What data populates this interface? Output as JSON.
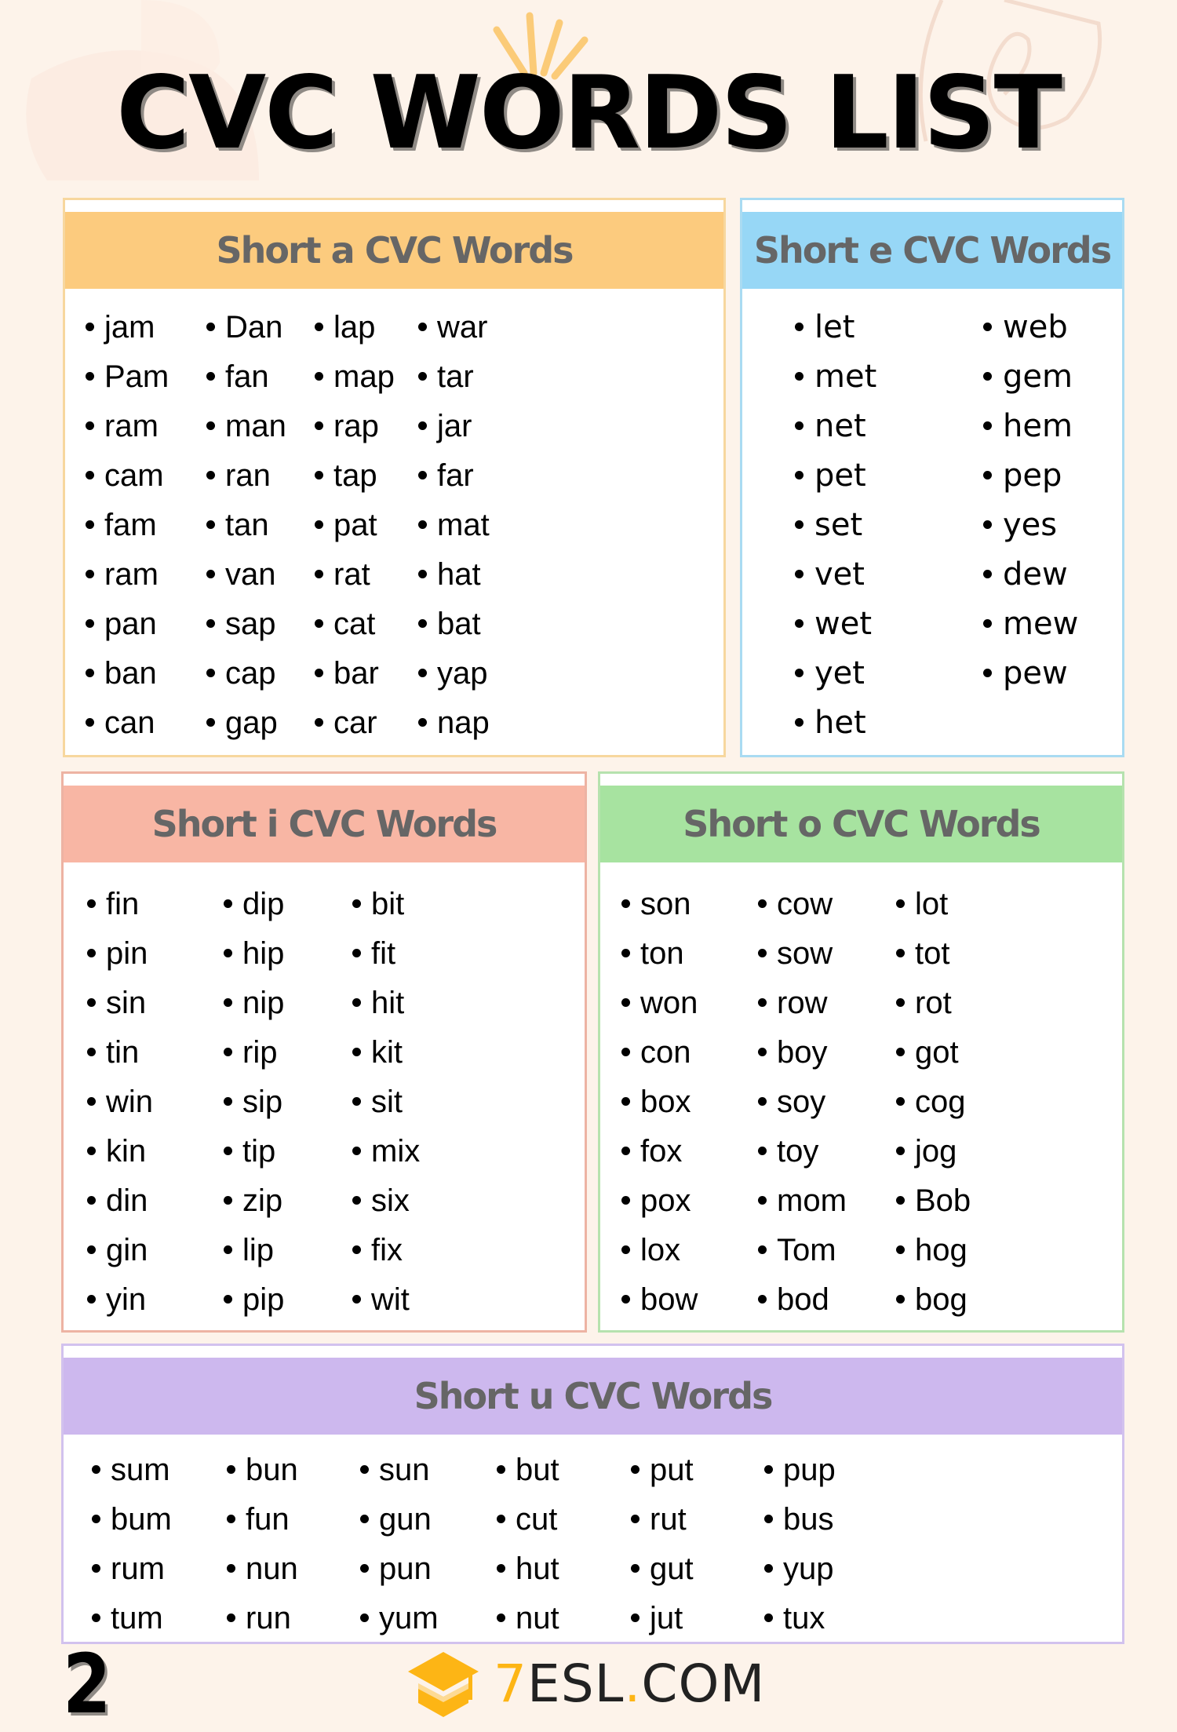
{
  "title": "CVC WORDS LIST",
  "colors": {
    "background": "#FDF3EA",
    "short_a": "#FCCB7E",
    "short_e": "#97D7F6",
    "short_i": "#F8B6A4",
    "short_o": "#A7E3A0",
    "short_u": "#CDB8EE",
    "header_text": "#666666",
    "logo_accent": "#FDB515"
  },
  "sections": {
    "a": {
      "heading": "Short a CVC Words",
      "columns": [
        [
          "jam",
          "Pam",
          "ram",
          "cam",
          "fam",
          "ram",
          "pan",
          "ban",
          "can"
        ],
        [
          "Dan",
          "fan",
          "man",
          "ran",
          "tan",
          "van",
          "sap",
          "cap",
          "gap"
        ],
        [
          "lap",
          "map",
          "rap",
          "tap",
          "pat",
          "rat",
          "cat",
          "bar",
          "car"
        ],
        [
          "war",
          "tar",
          "jar",
          "far",
          "mat",
          "hat",
          "bat",
          "yap",
          "nap"
        ]
      ]
    },
    "e": {
      "heading": "Short e CVC Words",
      "columns": [
        [
          "let",
          "met",
          "net",
          "pet",
          "set",
          "vet",
          "wet",
          "yet",
          "het"
        ],
        [
          "web",
          "gem",
          "hem",
          "pep",
          "yes",
          "dew",
          "mew",
          "pew"
        ]
      ]
    },
    "i": {
      "heading": "Short i CVC Words",
      "columns": [
        [
          "fin",
          "pin",
          "sin",
          "tin",
          "win",
          "kin",
          "din",
          "gin",
          "yin"
        ],
        [
          "dip",
          "hip",
          "nip",
          "rip",
          "sip",
          "tip",
          "zip",
          "lip",
          "pip"
        ],
        [
          "bit",
          "fit",
          "hit",
          "kit",
          "sit",
          "mix",
          "six",
          "fix",
          "wit"
        ]
      ]
    },
    "o": {
      "heading": "Short o CVC Words",
      "columns": [
        [
          "son",
          "ton",
          "won",
          "con",
          "box",
          "fox",
          "pox",
          "lox",
          "bow"
        ],
        [
          "cow",
          "sow",
          "row",
          "boy",
          "soy",
          "toy",
          "mom",
          "Tom",
          "bod"
        ],
        [
          "lot",
          "tot",
          "rot",
          "got",
          "cog",
          "jog",
          "Bob",
          "hog",
          "bog"
        ]
      ]
    },
    "u": {
      "heading": "Short u CVC Words",
      "columns": [
        [
          "sum",
          "bum",
          "rum",
          "tum"
        ],
        [
          "bun",
          "fun",
          "nun",
          "run"
        ],
        [
          "sun",
          "gun",
          "pun",
          "yum"
        ],
        [
          "but",
          "cut",
          "hut",
          "nut"
        ],
        [
          "put",
          "rut",
          "gut",
          "jut"
        ],
        [
          "pup",
          "bus",
          "yup",
          "tux"
        ]
      ]
    }
  },
  "footer": {
    "page_number": "2",
    "logo": {
      "icon": "graduation-cap-icon",
      "prefix": "7",
      "main": "ESL",
      "dot": ".",
      "suffix": "COM"
    }
  }
}
